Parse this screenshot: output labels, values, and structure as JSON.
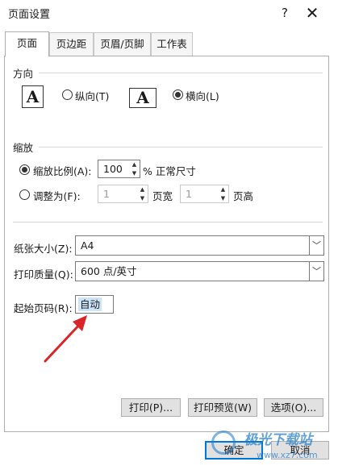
{
  "window": {
    "title": "页面设置",
    "help": "?",
    "close": "✕"
  },
  "tabs": [
    {
      "label": "页面",
      "active": true
    },
    {
      "label": "页边距",
      "active": false
    },
    {
      "label": "页眉/页脚",
      "active": false
    },
    {
      "label": "工作表",
      "active": false
    }
  ],
  "orientation": {
    "label": "方向",
    "portrait_letter": "A",
    "portrait_label": "纵向(T)",
    "landscape_letter": "A",
    "landscape_label": "横向(L)",
    "selected": "landscape"
  },
  "scaling": {
    "label": "缩放",
    "adjust_label": "缩放比例(A):",
    "adjust_value": "100",
    "adjust_suffix": "% 正常尺寸",
    "fit_label": "调整为(F):",
    "fit_wide_value": "1",
    "fit_wide_suffix": "页宽",
    "fit_tall_value": "1",
    "fit_tall_suffix": "页高",
    "selected": "adjust"
  },
  "paper": {
    "label": "纸张大小(Z):",
    "value": "A4"
  },
  "quality": {
    "label": "打印质量(Q):",
    "value": "600 点/英寸"
  },
  "first_page": {
    "label": "起始页码(R):",
    "value": "自动"
  },
  "buttons": {
    "print": "打印(P)...",
    "preview": "打印预览(W)",
    "options": "选项(O)...",
    "ok": "确定",
    "cancel": "取消"
  },
  "watermark": {
    "text": "极光下载站",
    "url": "www.xz7.com"
  },
  "colors": {
    "accent": "#0078d7",
    "arrow": "#d9252a",
    "selection": "#cce4f7"
  }
}
